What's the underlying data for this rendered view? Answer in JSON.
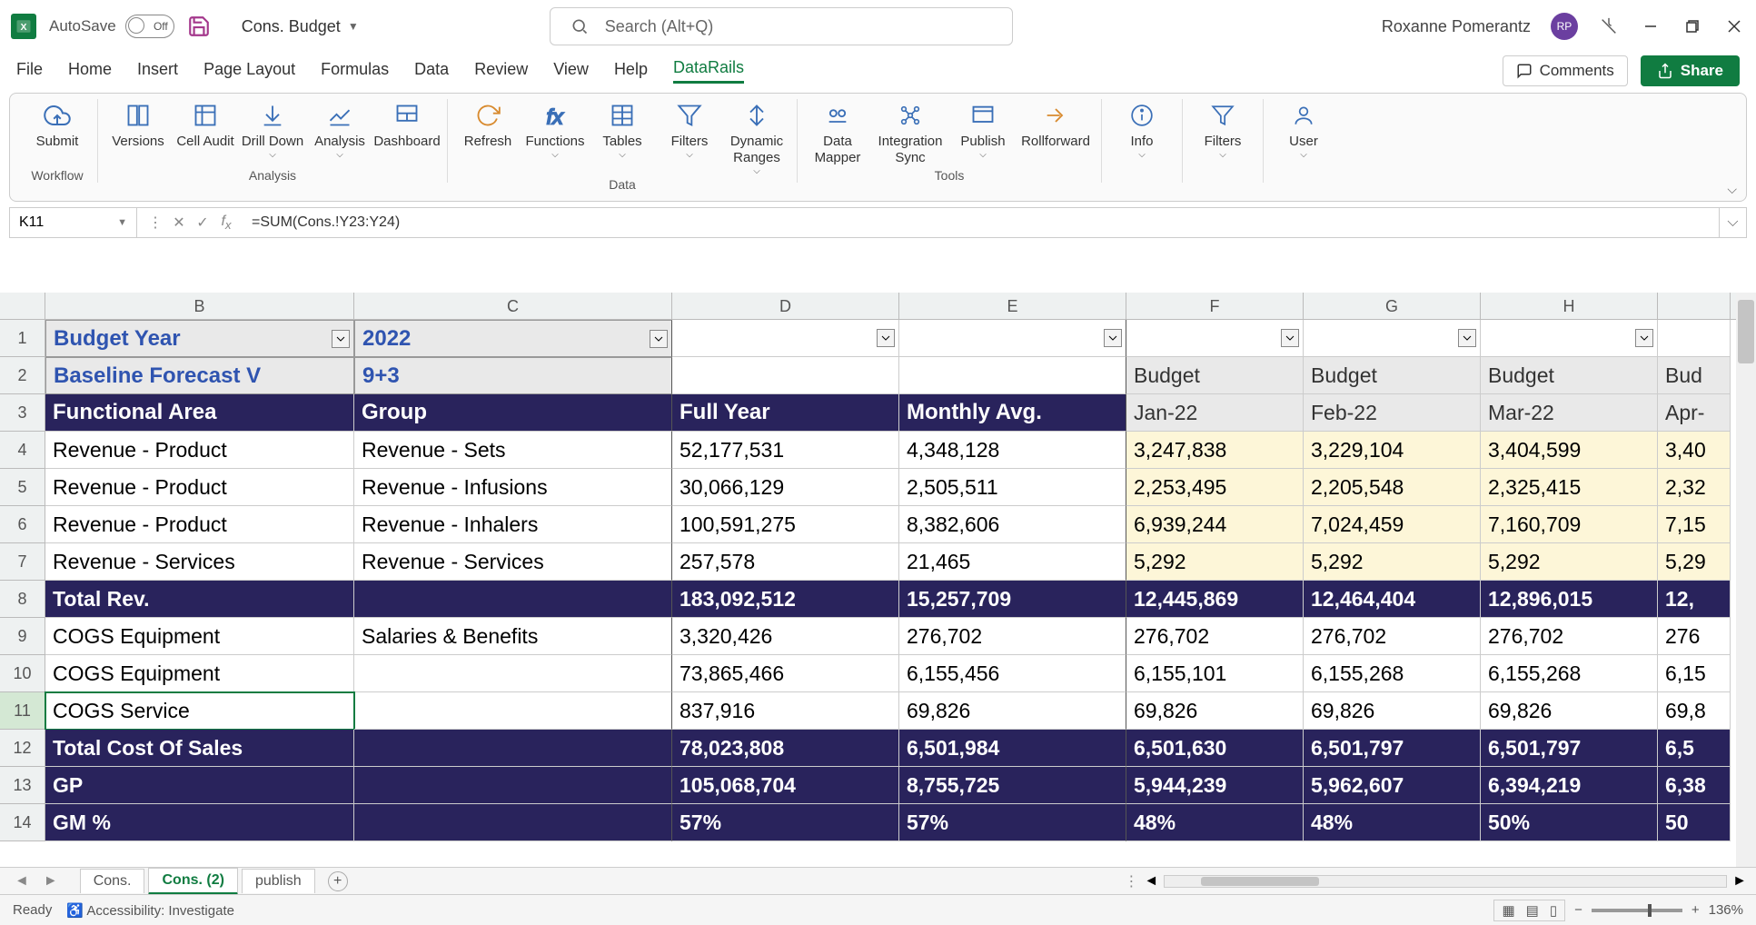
{
  "titlebar": {
    "autosave_label": "AutoSave",
    "autosave_state": "Off",
    "doc_title": "Cons. Budget",
    "search_placeholder": "Search (Alt+Q)",
    "user_name": "Roxanne Pomerantz",
    "user_initials": "RP"
  },
  "ribbon_tabs": [
    "File",
    "Home",
    "Insert",
    "Page Layout",
    "Formulas",
    "Data",
    "Review",
    "View",
    "Help",
    "DataRails"
  ],
  "active_tab": "DataRails",
  "comments_label": "Comments",
  "share_label": "Share",
  "ribbon_groups": {
    "group1_label": "Workflow",
    "group2_label": "Analysis",
    "group3_label": "Data",
    "group4_label": "Tools",
    "buttons": {
      "submit": "Submit",
      "versions": "Versions",
      "cell_audit": "Cell Audit",
      "drill_down": "Drill Down",
      "analysis": "Analysis",
      "dashboard": "Dashboard",
      "refresh": "Refresh",
      "functions": "Functions",
      "tables": "Tables",
      "filters": "Filters",
      "dynamic_ranges": "Dynamic Ranges",
      "data_mapper": "Data Mapper",
      "integration_sync": "Integration Sync",
      "publish": "Publish",
      "rollforward": "Rollforward",
      "info": "Info",
      "filters2": "Filters",
      "user": "User"
    }
  },
  "formula_bar": {
    "name_box": "K11",
    "formula": "=SUM(Cons.!Y23:Y24)"
  },
  "columns": [
    "B",
    "C",
    "D",
    "E",
    "F",
    "G",
    "H"
  ],
  "col_widths": {
    "rownum": 50,
    "B": 340,
    "C": 350,
    "D": 250,
    "E": 250,
    "F": 195,
    "G": 195,
    "H": 195,
    "I": 80
  },
  "header_rows": {
    "r1": {
      "label": "Budget Year",
      "value": "2022"
    },
    "r2": {
      "label": "Baseline Forecast V",
      "value": "9+3",
      "scenario": [
        "Budget",
        "Budget",
        "Budget",
        "Bud"
      ]
    },
    "r3": {
      "func_area": "Functional Area",
      "group": "Group",
      "full_year": "Full Year",
      "monthly_avg": "Monthly Avg.",
      "months": [
        "Jan-22",
        "Feb-22",
        "Mar-22",
        "Apr-"
      ]
    }
  },
  "rows": [
    {
      "n": 4,
      "fa": "Revenue - Product",
      "grp": "Revenue - Sets",
      "fy": "52,177,531",
      "avg": "4,348,128",
      "m": [
        "3,247,838",
        "3,229,104",
        "3,404,599",
        "3,40"
      ],
      "y": true
    },
    {
      "n": 5,
      "fa": "Revenue - Product",
      "grp": "Revenue - Infusions",
      "fy": "30,066,129",
      "avg": "2,505,511",
      "m": [
        "2,253,495",
        "2,205,548",
        "2,325,415",
        "2,32"
      ],
      "y": true
    },
    {
      "n": 6,
      "fa": "Revenue - Product",
      "grp": "Revenue - Inhalers",
      "fy": "100,591,275",
      "avg": "8,382,606",
      "m": [
        "6,939,244",
        "7,024,459",
        "7,160,709",
        "7,15"
      ],
      "y": true
    },
    {
      "n": 7,
      "fa": "Revenue - Services",
      "grp": "Revenue - Services",
      "fy": "257,578",
      "avg": "21,465",
      "m": [
        "5,292",
        "5,292",
        "5,292",
        "5,29"
      ],
      "y": true
    },
    {
      "n": 8,
      "fa": "Total Rev.",
      "grp": "",
      "fy": "183,092,512",
      "avg": "15,257,709",
      "m": [
        "12,445,869",
        "12,464,404",
        "12,896,015",
        "12,"
      ],
      "tot": true
    },
    {
      "n": 9,
      "fa": "COGS Equipment",
      "grp": "Salaries & Benefits",
      "fy": "3,320,426",
      "avg": "276,702",
      "m": [
        "276,702",
        "276,702",
        "276,702",
        "276"
      ]
    },
    {
      "n": 10,
      "fa": "COGS Equipment",
      "grp": "",
      "fy": "73,865,466",
      "avg": "6,155,456",
      "m": [
        "6,155,101",
        "6,155,268",
        "6,155,268",
        "6,15"
      ]
    },
    {
      "n": 11,
      "fa": "COGS Service",
      "grp": "",
      "fy": "837,916",
      "avg": "69,826",
      "m": [
        "69,826",
        "69,826",
        "69,826",
        "69,8"
      ],
      "sel": true
    },
    {
      "n": 12,
      "fa": "Total Cost Of Sales",
      "grp": "",
      "fy": "78,023,808",
      "avg": "6,501,984",
      "m": [
        "6,501,630",
        "6,501,797",
        "6,501,797",
        "6,5"
      ],
      "tot": true
    },
    {
      "n": 13,
      "fa": "GP",
      "grp": "",
      "fy": "105,068,704",
      "avg": "8,755,725",
      "m": [
        "5,944,239",
        "5,962,607",
        "6,394,219",
        "6,38"
      ],
      "tot": true
    },
    {
      "n": 14,
      "fa": "GM %",
      "grp": "",
      "fy": "57%",
      "avg": "57%",
      "m": [
        "48%",
        "48%",
        "50%",
        "50"
      ],
      "tot": true
    }
  ],
  "sheet_tabs": [
    "Cons.",
    "Cons. (2)",
    "publish"
  ],
  "active_sheet": "Cons. (2)",
  "status_bar": {
    "ready": "Ready",
    "accessibility": "Accessibility: Investigate",
    "zoom": "136%"
  }
}
